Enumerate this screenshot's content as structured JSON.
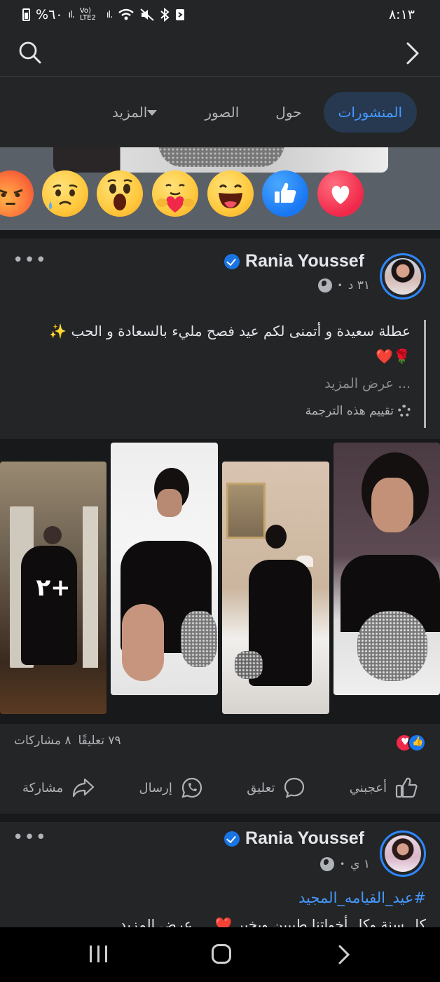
{
  "status_bar": {
    "battery": "%٦٠",
    "network": "Vo) LTE2",
    "time": "٨:١٣"
  },
  "top_bar": {
    "search_icon": "search-icon",
    "back_icon": "chevron-right-icon"
  },
  "tabs": [
    {
      "label": "المنشورات",
      "active": true
    },
    {
      "label": "حول",
      "active": false
    },
    {
      "label": "الصور",
      "active": false
    },
    {
      "label": "المزيد",
      "active": false
    }
  ],
  "reactions_strip": {
    "items": [
      "love-icon",
      "like-icon",
      "haha-icon",
      "care-icon",
      "wow-icon",
      "sad-icon",
      "angry-icon"
    ]
  },
  "post1": {
    "author": "Rania Youssef",
    "verified": true,
    "time": "٣١ د",
    "privacy_icon": "globe-icon",
    "text_line1": "عطلة سعيدة و أتمنى لكم عيد فصح مليء بالسعادة و الحب ✨",
    "text_line2": "🌹❤️",
    "see_more": "... عرض المزيد",
    "rate_translation": "تقييم هذه الترجمة",
    "photos_more": "٢+",
    "reactions_count_icons": [
      "like-icon",
      "love-icon"
    ],
    "comments": "٧٩ تعليقًا",
    "shares": "٨ مشاركات",
    "actions": {
      "like": "أعجبني",
      "comment": "تعليق",
      "send": "إرسال",
      "share": "مشاركة"
    }
  },
  "post2": {
    "author": "Rania Youssef",
    "verified": true,
    "time": "١ ي",
    "hashtag": "#عيد_القيامه_المجيد",
    "text_cut": "كل سنة وكل أخواتنا طيبين وبخير ❤️ ... عرض المزيد"
  },
  "colors": {
    "background": "#242526",
    "accent": "#4599ff",
    "tab_active_bg": "#263951",
    "verified": "#1b74e4"
  }
}
